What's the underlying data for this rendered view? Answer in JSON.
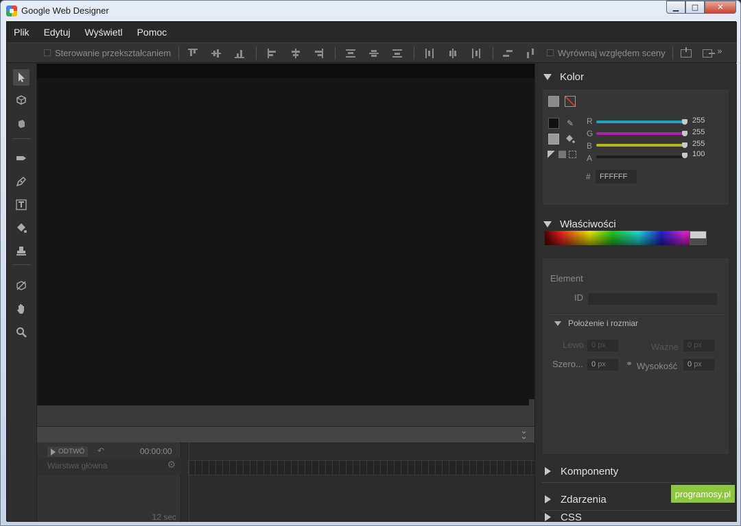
{
  "window": {
    "title": "Google Web Designer",
    "controls": {
      "minimize": "▁",
      "maximize": "□",
      "close": "✕"
    }
  },
  "menu": [
    "Plik",
    "Edytuj",
    "Wyświetl",
    "Pomoc"
  ],
  "toolbar": {
    "transform_label": "Sterowanie przekształcaniem",
    "align_scene_label": "Wyrównaj względem sceny"
  },
  "left_tools": [
    "selection-tool-icon",
    "3d-rotation-tool-icon",
    "3d-translation-tool-icon",
    "tag-tool-icon",
    "pen-tool-icon",
    "text-tool-icon",
    "fill-tool-icon",
    "stamp-tool-icon",
    "3d-transform-tool-icon",
    "hand-tool-icon",
    "zoom-tool-icon"
  ],
  "timeline": {
    "play_label": "ODTWÓ",
    "time": "00:00:00",
    "layer_name": "Warstwa główna",
    "duration": "12 sec"
  },
  "panels": {
    "color": {
      "title": "Kolor",
      "channels": [
        {
          "label": "R",
          "value": "255",
          "color": "#1aa6b7"
        },
        {
          "label": "G",
          "value": "255",
          "color": "#b21bb4"
        },
        {
          "label": "B",
          "value": "255",
          "color": "#b6b41c"
        },
        {
          "label": "A",
          "value": "100",
          "color": "#1c1c1c"
        }
      ],
      "hex_label": "#",
      "hex_value": "FFFFFF"
    },
    "properties": {
      "title": "Właściwości",
      "element_label": "Element",
      "id_label": "ID",
      "position_section": "Położenie i rozmiar",
      "left_label": "Lewo",
      "left_value": "0",
      "top_label": "Ważne",
      "top_value": "0",
      "width_label": "Szero...",
      "width_value": "0",
      "height_label": "Wysokość",
      "height_value": "0",
      "unit": "px"
    },
    "components": {
      "title": "Komponenty"
    },
    "events": {
      "title": "Zdarzenia"
    },
    "css": {
      "title": "CSS"
    }
  },
  "watermark": "programosy.pl"
}
